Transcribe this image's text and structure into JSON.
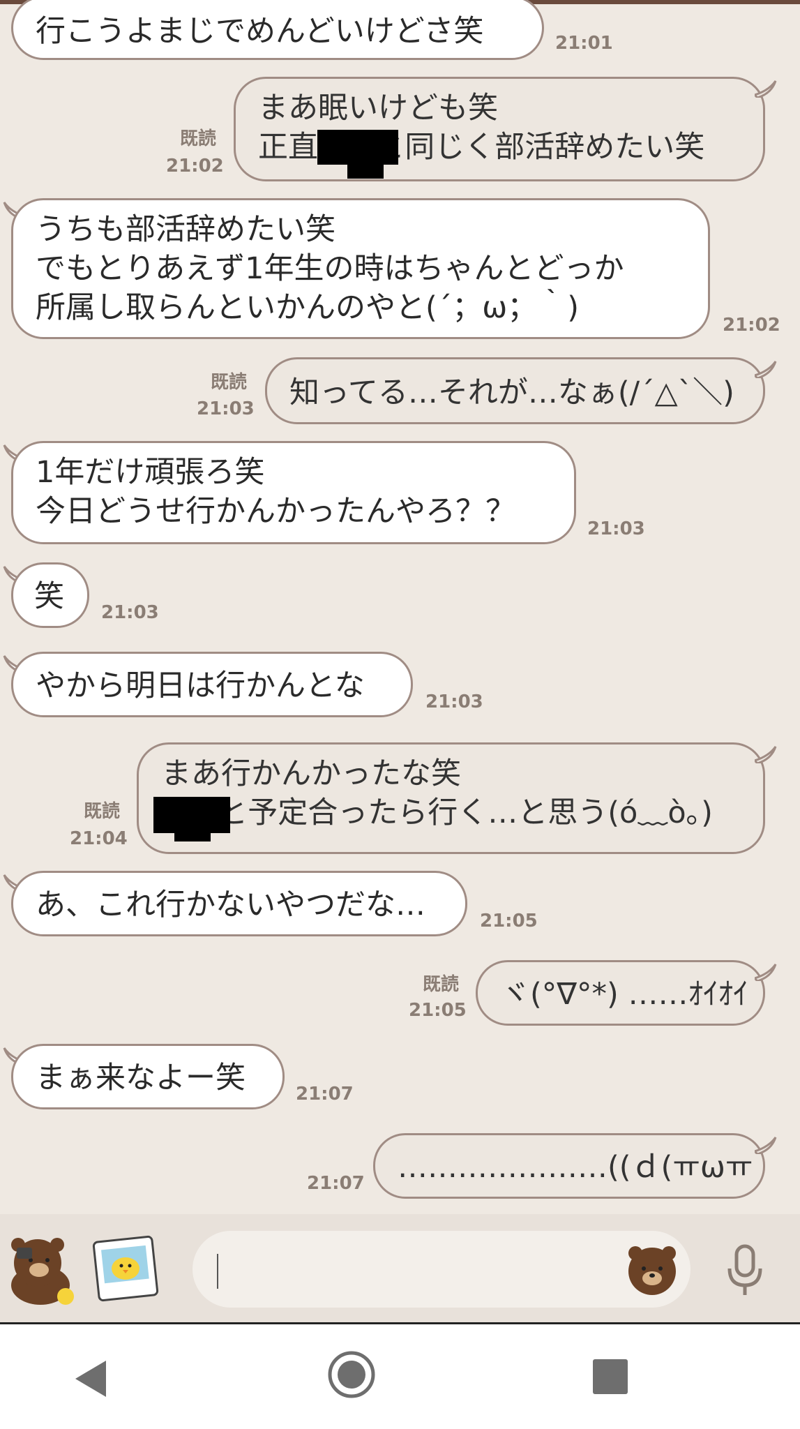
{
  "messages": [
    {
      "dir": "in",
      "text": "行こうよまじでめんどいけどさ笑",
      "time": "21:01"
    },
    {
      "dir": "out",
      "text": "まあ眠いけども笑\n正直■■と同じく部活辞めたい笑",
      "time": "21:02",
      "read": "既読"
    },
    {
      "dir": "in",
      "text": "うちも部活辞めたい笑\nでもとりあえず1年生の時はちゃんとどっか\n所属し取らんといかんのやと(´；ω；｀)",
      "time": "21:02"
    },
    {
      "dir": "out",
      "text": "知ってる…それが…なぁ(/´△`＼)",
      "time": "21:03",
      "read": "既読"
    },
    {
      "dir": "in",
      "text": "1年だけ頑張ろ笑\n今日どうせ行かんかったんやろ？？",
      "time": "21:03"
    },
    {
      "dir": "in",
      "text": "笑",
      "time": "21:03"
    },
    {
      "dir": "in",
      "text": "やから明日は行かんとな",
      "time": "21:03"
    },
    {
      "dir": "out",
      "text": "まあ行かんかったな笑\n■■と予定合ったら行く…と思う(ó﹏ò｡)",
      "time": "21:04",
      "read": "既読"
    },
    {
      "dir": "in",
      "text": "あ、これ行かないやつだな…",
      "time": "21:05"
    },
    {
      "dir": "out",
      "text": "ヾ(°∇°*) ……ｵｲｵｲ",
      "time": "21:05",
      "read": "既読"
    },
    {
      "dir": "in",
      "text": "まぁ来なよー笑",
      "time": "21:07"
    },
    {
      "dir": "out",
      "text": "…………………((ｄ(ㅠωㅠ｀)",
      "time": "21:07"
    }
  ],
  "input": {
    "value": ""
  },
  "colors": {
    "background": "#efe9e2",
    "bubble_in": "#ffffff",
    "bubble_out": "#ede7e0",
    "border": "#a08c84",
    "timestamp": "#8a7d74"
  },
  "icons": {
    "sticker": "brown-bear-sticker-icon",
    "photo": "photo-sticker-icon",
    "emoji": "brown-bear-emoji-icon",
    "mic": "microphone-icon",
    "back": "nav-back-icon",
    "home": "nav-home-icon",
    "recent": "nav-recent-apps-icon"
  }
}
